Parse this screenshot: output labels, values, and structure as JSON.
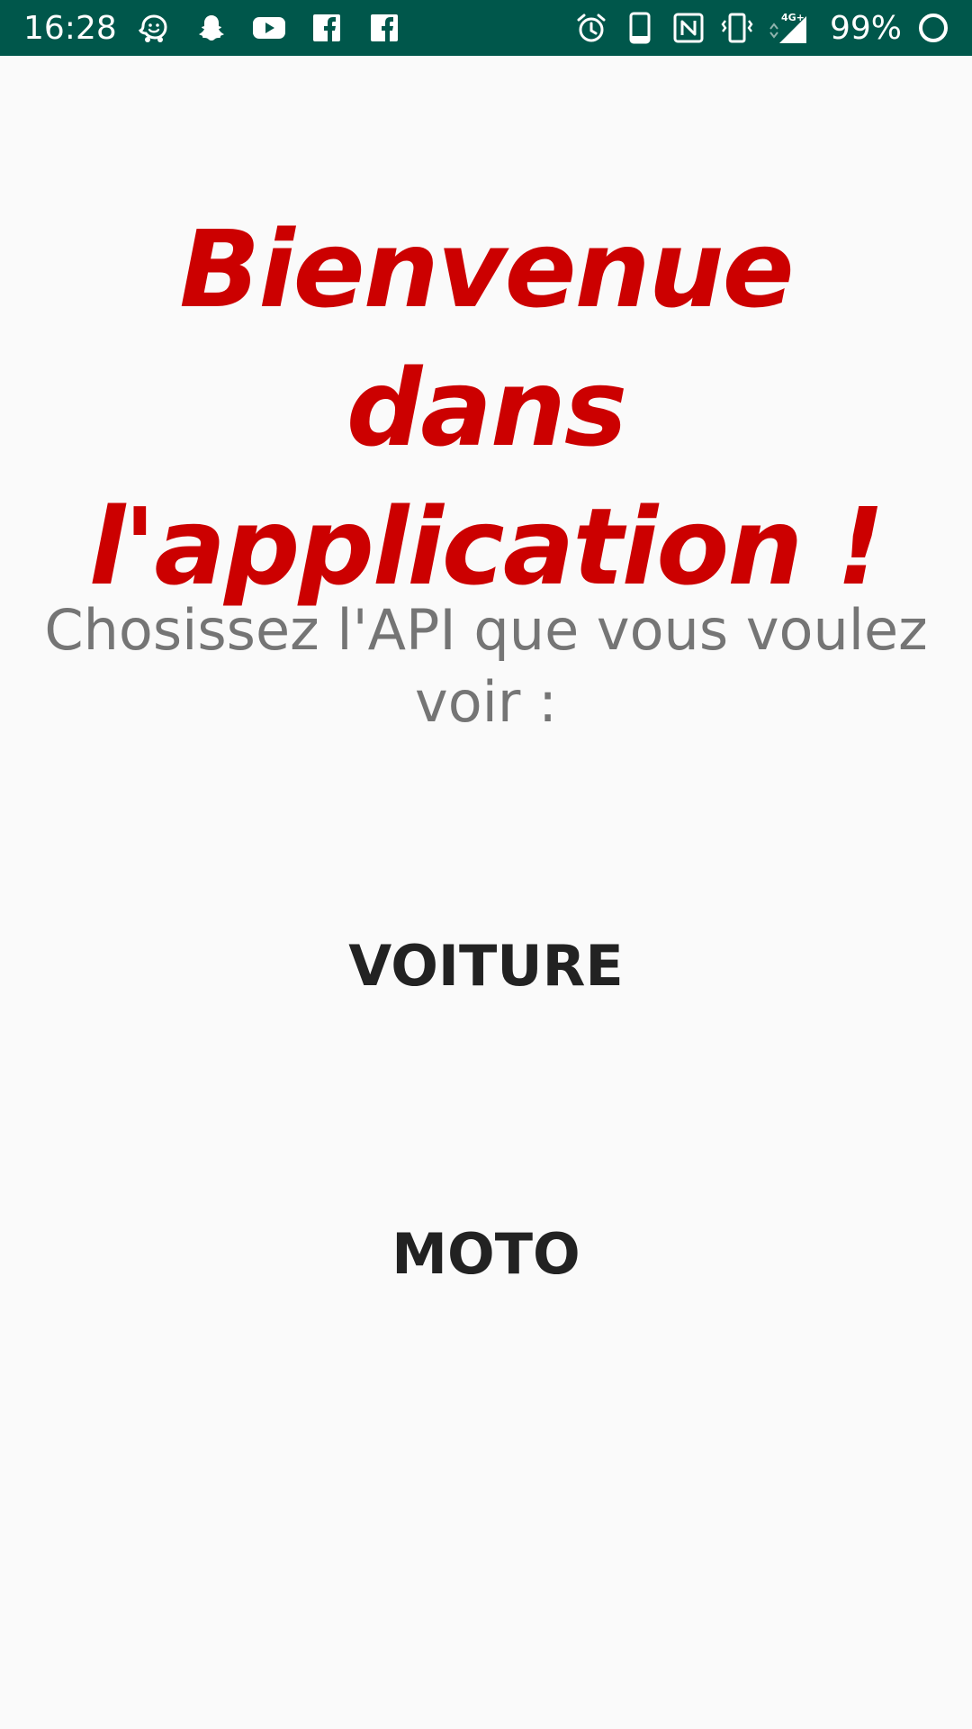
{
  "status_bar": {
    "time": "16:28",
    "battery_percent": "99%",
    "notification_icons": [
      "waze-icon",
      "snapchat-icon",
      "youtube-icon",
      "facebook-icon",
      "facebook-icon"
    ],
    "system_icons": [
      "alarm-icon",
      "phone-icon",
      "nfc-icon",
      "vibrate-icon",
      "signal-icon",
      "battery-icon"
    ],
    "network_label": "4G+",
    "background_color": "#00574b"
  },
  "main": {
    "title": "Bienvenue dans l'application !",
    "title_color": "#cc0000",
    "subtitle": "Chosissez l'API que vous voulez voir :",
    "buttons": {
      "voiture": "VOITURE",
      "moto": "MOTO"
    }
  }
}
